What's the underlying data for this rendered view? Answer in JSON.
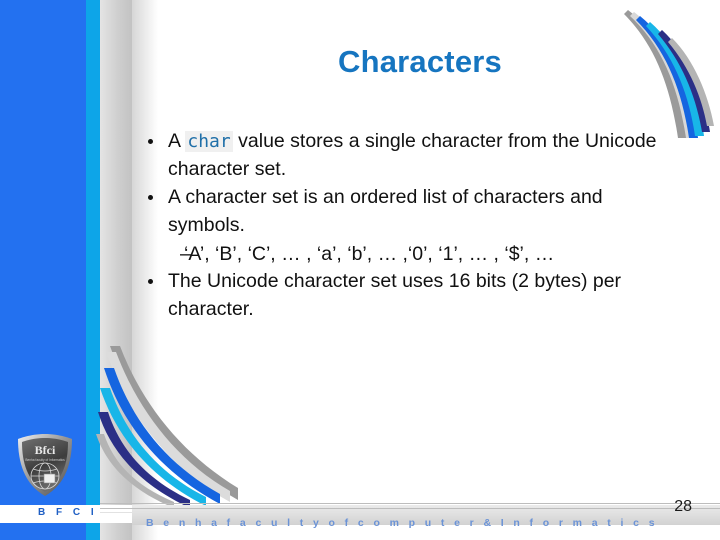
{
  "slide": {
    "title": "Characters",
    "page_number": "28",
    "title_color": "#1675c0",
    "accent_blue": "#2371f0",
    "accent_cyan": "#0da5e8",
    "code_color": "#1f6fa8"
  },
  "content": {
    "bullets": [
      {
        "prefix": "A ",
        "code": "char",
        "suffix": " value stores a single character from the Unicode character set."
      },
      {
        "prefix": "A character set is an ordered list of characters and symbols.",
        "code": "",
        "suffix": ""
      },
      {
        "prefix": "The Unicode character set uses 16 bits (2 bytes) per character.",
        "code": "",
        "suffix": ""
      }
    ],
    "sub_bullet": {
      "dash": "–",
      "text": "‘A’, ‘B’, ‘C’, … , ‘a’, ‘b’, … ,‘0’, ‘1’, … , ‘$’, …"
    }
  },
  "logo": {
    "badge_text": "Bfci",
    "badge_subtext": "Benha  faculty of  Informatics",
    "strip_label": "B F C I"
  },
  "footer": {
    "text": "B e n h a    f a c u l t y    o f    c o m p u t e r    &    I n f o r m a t i c s"
  }
}
